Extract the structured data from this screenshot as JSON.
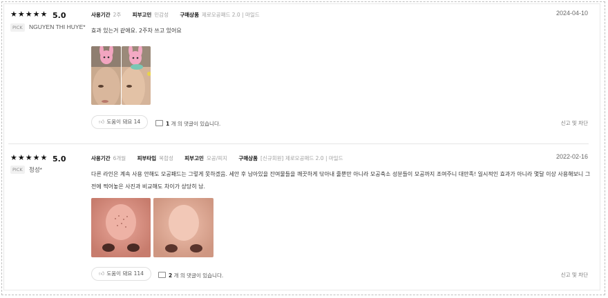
{
  "reviews": [
    {
      "rating_stars": "★★★★★",
      "rating": "5.0",
      "pick_badge": "PICK",
      "author": "NGUYEN THI HUYE*",
      "date": "2024-04-10",
      "meta": [
        {
          "key": "사용기간",
          "value": "2주"
        },
        {
          "key": "피부고민",
          "value": "민감성"
        },
        {
          "key": "구매상품",
          "value": "제로모공패드 2.0 | 마일드"
        }
      ],
      "text": "효과 있는거 같애요. 2주차 쓰고 있어요",
      "helpful_label": "도움이 돼요 14",
      "comments_count": "1",
      "comments_suffix": "개 의 댓글이 있습니다.",
      "report_label": "신고 및 차단"
    },
    {
      "rating_stars": "★★★★★",
      "rating": "5.0",
      "pick_badge": "PICK",
      "author": "정성*",
      "date": "2022-02-16",
      "meta": [
        {
          "key": "사용기간",
          "value": "6개월"
        },
        {
          "key": "피부타입",
          "value": "복합성"
        },
        {
          "key": "피부고민",
          "value": "모공/피지"
        },
        {
          "key": "구매상품",
          "value": "[신규회원] 제로모공패드 2.0 | 마일드"
        }
      ],
      "text": "다른 라인은 계속 사용 안해도 모공패드는 그렇게 못하겠음. 세안 후 남아있을 잔여물들을 깨끗하게 닦아내 줄뿐만 아니라 모공축소 성분들이 모공까지 조여주니 대만족! 일시적인 효과가 아니라 몇달 이상 사용해보니 그전에 찍어놓은 사진과 비교해도 차이가 상당히 남.",
      "helpful_label": "도움이 돼요 114",
      "comments_count": "2",
      "comments_suffix": "개 의 댓글이 있습니다.",
      "report_label": "신고 및 차단"
    }
  ],
  "colors": {
    "star": "#111111",
    "divider": "#e6e6e6",
    "muted": "#a0a0a0"
  },
  "icons": [
    "star-icon",
    "thumbs-up-icon",
    "comment-icon"
  ]
}
